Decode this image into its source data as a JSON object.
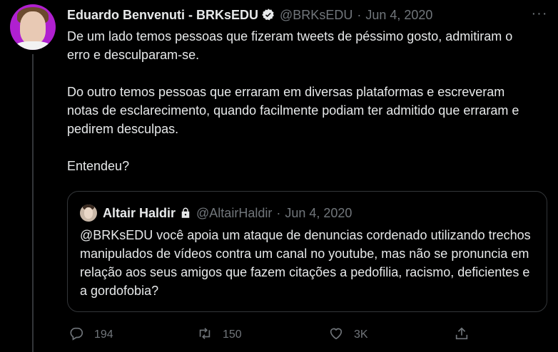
{
  "tweet": {
    "author_name": "Eduardo Benvenuti - BRKsEDU",
    "author_handle": "@BRKsEDU",
    "separator": "·",
    "date": "Jun 4, 2020",
    "more_label": "···",
    "paragraphs": [
      "De um lado temos pessoas que fizeram tweets de péssimo gosto, admitiram o erro e desculparam-se.",
      "Do outro temos pessoas que erraram em diversas plataformas e escreveram notas de esclarecimento, quando facilmente podiam ter admitido que erraram e pedirem desculpas.",
      "Entendeu?"
    ]
  },
  "quote": {
    "author_name": "Altair Haldir",
    "author_handle": "@AltairHaldir",
    "separator": "·",
    "date": "Jun 4, 2020",
    "text": "@BRKsEDU você apoia um ataque de denuncias cordenado utilizando trechos manipulados de vídeos contra um canal no youtube, mas não se pronuncia em relação aos seus amigos que fazem citações a pedofilia, racismo, deficientes e a gordofobia?"
  },
  "actions": {
    "reply_count": "194",
    "retweet_count": "150",
    "like_count": "3K"
  },
  "icons": {
    "reply": "reply-icon",
    "retweet": "retweet-icon",
    "like": "heart-icon",
    "share": "share-icon",
    "verified": "verified-badge-icon",
    "lock": "lock-icon"
  },
  "colors": {
    "background": "#000000",
    "text": "#e7e9ea",
    "muted": "#71767b",
    "border": "#333639"
  }
}
